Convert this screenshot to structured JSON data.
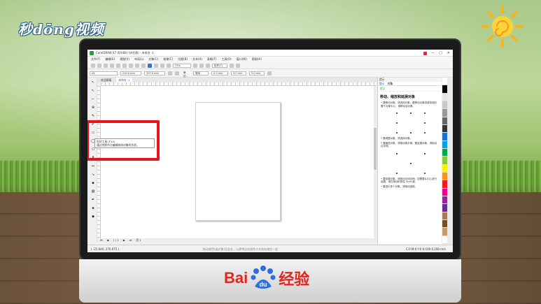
{
  "overlay": {
    "brand": "秒dōng视频",
    "footer_brand_left": "Bai",
    "footer_brand_mid": "du",
    "footer_brand_right": "经验"
  },
  "app": {
    "title": "CorelDRAW X7 (64-Bit) (评估版) - 未命名 -1",
    "menu": [
      "文件(F)",
      "编辑(E)",
      "视图(V)",
      "布局(L)",
      "对象(C)",
      "效果(C)",
      "位图(B)",
      "文本(X)",
      "表格(T)",
      "工具(O)",
      "窗口(W)",
      "帮助(H)"
    ],
    "zoom": "37%",
    "snap_label": "贴齐(T)",
    "page_size": "A4",
    "width": "210.0 mm",
    "height": "297.0 mm",
    "units_label": "单位:",
    "units": "毫米",
    "nudge": "0.1 mm",
    "dup_x": "5.0 mm",
    "dup_y": "5.0 mm",
    "tabs": [
      "欢迎屏幕",
      "未命名 -1"
    ],
    "tooltip_title": "形状工具 (F10)",
    "tooltip_desc": "通过控制节点编辑曲线对象的形状。",
    "page_nav": "1 / 1",
    "page_label": "页 1",
    "status_left": "( -25.640, 270.075 )",
    "status_center": "拖动颜色(或对象)至此处，以便将这些颜色与文档存储在一起",
    "status_right": "C:0 M:0 Y:0 K:100  0.200 mm"
  },
  "docker": {
    "header": "提示",
    "tabs": [
      "提示",
      "对象"
    ],
    "sub_header": "提示",
    "title": "移动、缩放和延展对象",
    "p1": "• 要移动对象，请选择对象，要移动对象将鼠标指针置于对象中心，请移动该对象。",
    "p2": "• 要调整对象，请选择对象。",
    "p3": "• 要缩放对象，请拖动角手柄。要延展对象，请拖动边手柄。",
    "p4": "• 要延展对象，请拖动中间手柄，如需要从中心进行延展，请在拖动时按住 Shift 键。",
    "p5": "• 要选中多个对象，请拖动选框。"
  },
  "colors": {
    "highlight": "#e8141c",
    "palette": [
      "#ffffff",
      "#000000",
      "#e5e5e5",
      "#c8c8c8",
      "#999999",
      "#666666",
      "#333333",
      "#1d6fd1",
      "#00a3e0",
      "#00a651",
      "#8dc63f",
      "#fff200",
      "#f7941d",
      "#ed1c24",
      "#ec008c",
      "#92278f",
      "#662d91",
      "#a67c52",
      "#754c24",
      "#c69c6d",
      "#ffffff"
    ]
  }
}
